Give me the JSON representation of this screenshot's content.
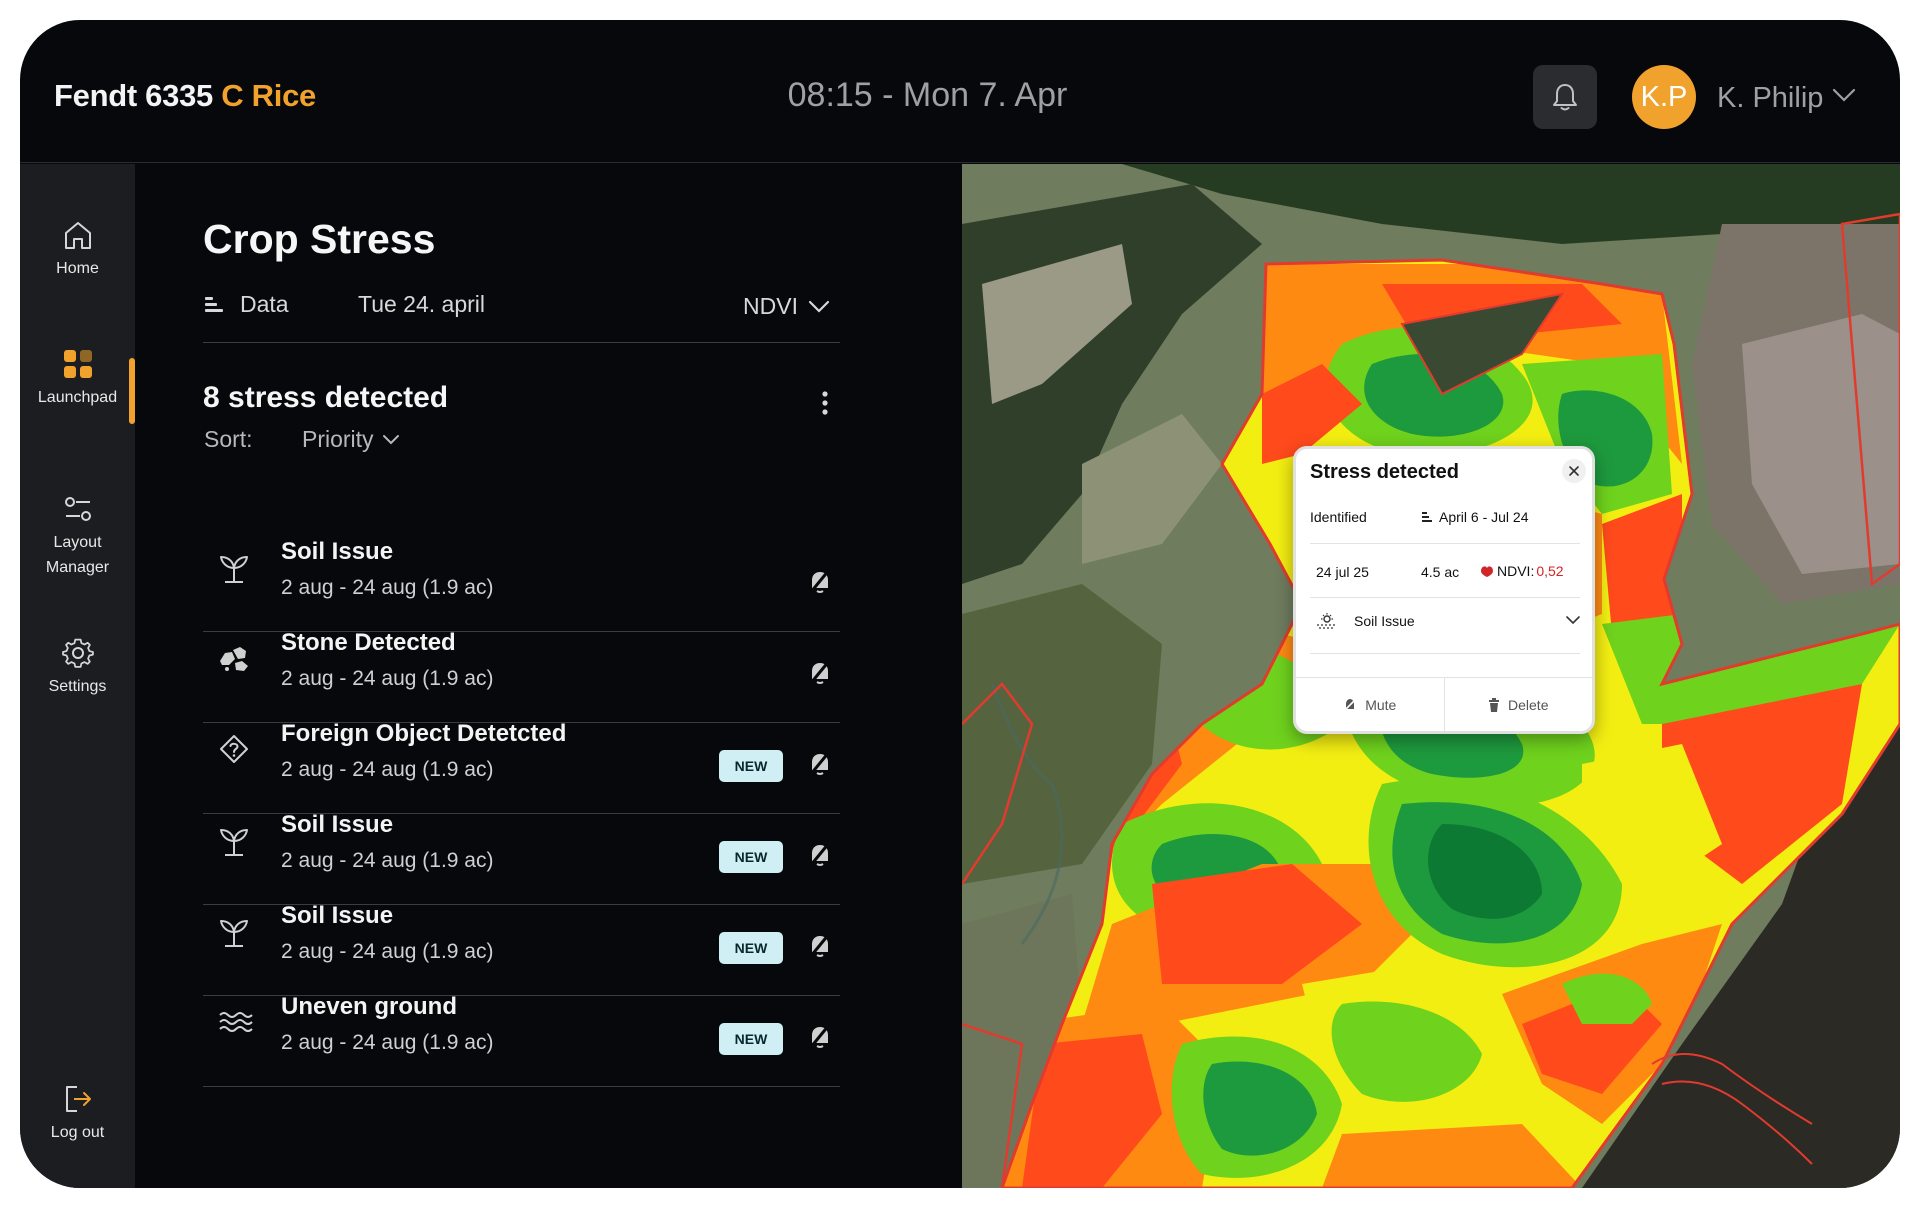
{
  "header": {
    "brand_main": "Fendt 6335",
    "brand_accent": "C Rice",
    "datetime": "08:15 - Mon 7. Apr",
    "user_initials": "K.P",
    "user_name": "K. Philip"
  },
  "sidebar": {
    "items": [
      {
        "label": "Home",
        "icon": "home-icon"
      },
      {
        "label": "Launchpad",
        "icon": "grid-icon",
        "active": true
      },
      {
        "label": "Layout\nManager",
        "icon": "sliders-icon"
      },
      {
        "label": "Settings",
        "icon": "gear-icon"
      }
    ],
    "logout": "Log out"
  },
  "panel": {
    "title": "Crop Stress",
    "data_label": "Data",
    "data_date": "Tue 24. april",
    "layer": "NDVI",
    "count": "8 stress detected",
    "sort_label": "Sort:",
    "sort_value": "Priority"
  },
  "stress_items": [
    {
      "title": "Soil Issue",
      "subtitle": "2 aug - 24 aug (1.9 ac)",
      "icon": "sprout-icon",
      "new": false
    },
    {
      "title": "Stone Detected",
      "subtitle": "2 aug - 24 aug (1.9 ac)",
      "icon": "stones-icon",
      "new": false
    },
    {
      "title": "Foreign Object Detetcted",
      "subtitle": "2 aug - 24 aug (1.9 ac)",
      "icon": "diamond-question-icon",
      "new": true
    },
    {
      "title": "Soil Issue",
      "subtitle": "2 aug - 24 aug (1.9 ac)",
      "icon": "sprout-icon",
      "new": true
    },
    {
      "title": "Soil Issue",
      "subtitle": "2 aug - 24 aug (1.9 ac)",
      "icon": "sprout-icon",
      "new": true
    },
    {
      "title": "Uneven ground",
      "subtitle": "2 aug - 24 aug (1.9 ac)",
      "icon": "waves-icon",
      "new": true
    }
  ],
  "badge_label": "NEW",
  "popup": {
    "title": "Stress detected",
    "identified_label": "Identified",
    "range": "April 6 - Jul 24",
    "date": "24 jul 25",
    "area": "4.5 ac",
    "ndvi_label": "NDVI:",
    "ndvi_value": "0,52",
    "issue": "Soil Issue",
    "mute": "Mute",
    "delete": "Delete"
  },
  "colors": {
    "accent": "#f0a22c",
    "badge_bg": "#cfeff5",
    "ndvi_red": "#ff4a1c",
    "ndvi_orange": "#ff8a12",
    "ndvi_yellow": "#f3ee12",
    "ndvi_lightgreen": "#6fd21d",
    "ndvi_green": "#1e9a3e",
    "ndvi_darkgreen": "#0d7a33"
  }
}
